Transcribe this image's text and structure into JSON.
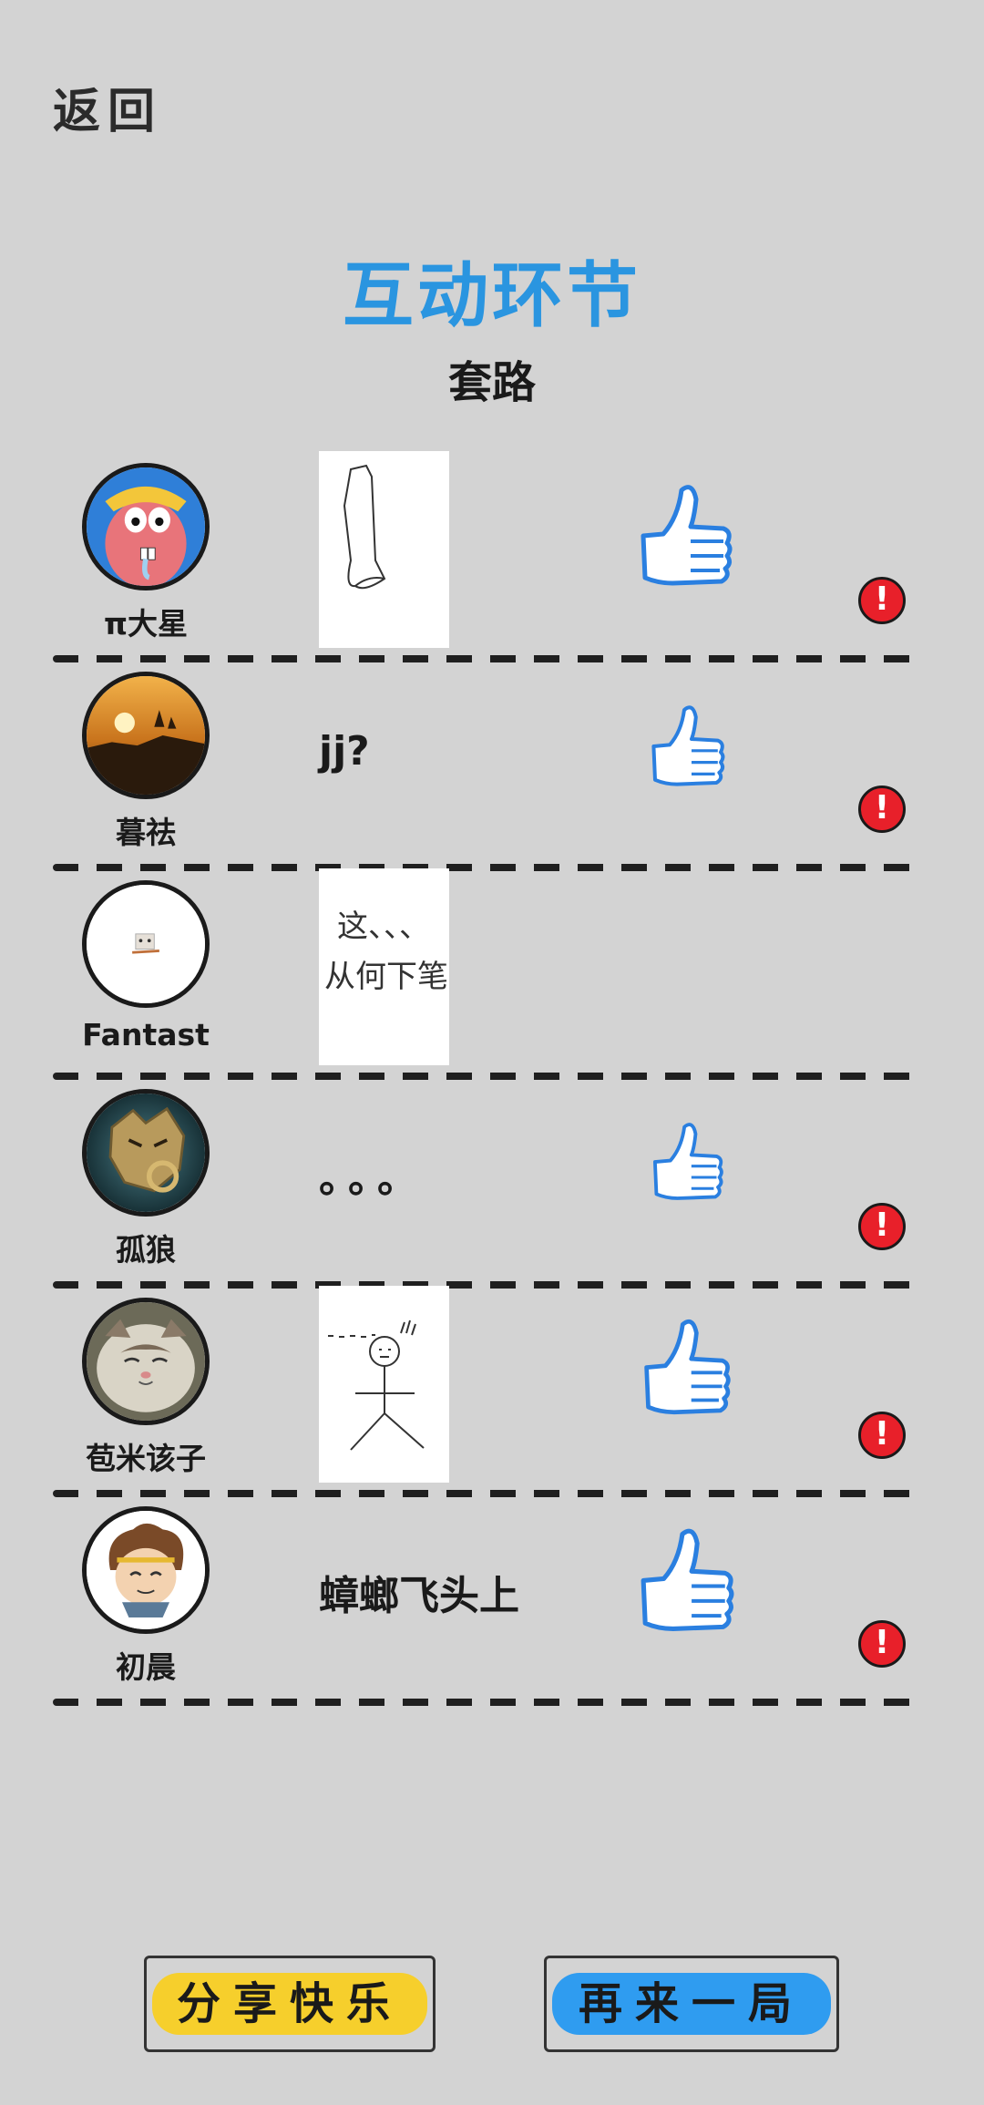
{
  "nav": {
    "back_label": "返回"
  },
  "header": {
    "title": "互动环节",
    "subtitle": "套路"
  },
  "colors": {
    "background": "#d3d3d3",
    "title": "#2a95e0",
    "thumb": "#2a7fe0",
    "report": "#e8202a",
    "share_btn": "#f6cf2c",
    "again_btn": "#2f9cf0"
  },
  "entries": [
    {
      "username": "π大星",
      "answer_type": "drawing",
      "answer_text": "",
      "liked_icon": "thumbs-up-icon",
      "report_icon": "report-icon"
    },
    {
      "username": "暮祛",
      "answer_type": "text",
      "answer_text": "jj?",
      "liked_icon": "thumbs-up-icon",
      "report_icon": "report-icon"
    },
    {
      "username": "Fantast",
      "answer_type": "drawing",
      "answer_text": "这、、、从何下笔",
      "liked_icon": "",
      "report_icon": ""
    },
    {
      "username": "孤狼",
      "answer_type": "text",
      "answer_text": "。。。",
      "liked_icon": "thumbs-up-icon",
      "report_icon": "report-icon"
    },
    {
      "username": "苞米该子",
      "answer_type": "drawing",
      "answer_text": "",
      "liked_icon": "thumbs-up-icon",
      "report_icon": "report-icon"
    },
    {
      "username": "初晨",
      "answer_type": "text",
      "answer_text": "蟑螂飞头上",
      "liked_icon": "thumbs-up-icon",
      "report_icon": "report-icon"
    }
  ],
  "buttons": {
    "share_label": "分享快乐",
    "again_label": "再来一局"
  }
}
